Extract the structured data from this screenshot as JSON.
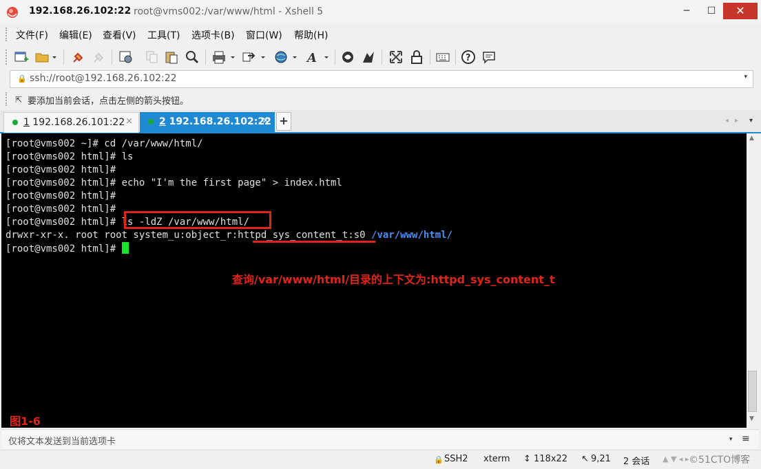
{
  "window": {
    "title_host": "192.168.26.102:22",
    "title_path": "root@vms002:/var/www/html - Xshell 5",
    "minimize": "─",
    "maximize": "☐",
    "close": "✕"
  },
  "menu": [
    "文件(F)",
    "编辑(E)",
    "查看(V)",
    "工具(T)",
    "选项卡(B)",
    "窗口(W)",
    "帮助(H)"
  ],
  "toolbar_icons": [
    "new-session-icon",
    "open-folder-icon",
    "reconnect-icon",
    "disconnect-icon",
    "properties-icon",
    "copy-icon",
    "paste-icon",
    "find-icon",
    "print-icon",
    "transfer-icon",
    "globe-icon",
    "font-icon",
    "xftp-icon",
    "xmanager-icon",
    "fullscreen-icon",
    "lock-icon",
    "keyboard-icon",
    "help-icon",
    "chat-icon"
  ],
  "address": {
    "value": "ssh://root@192.168.26.102:22",
    "lock": "🔒",
    "dropdown": "▾"
  },
  "hint": {
    "icon": "⇱",
    "text": "要添加当前会话，点击左侧的箭头按钮。"
  },
  "tabs": [
    {
      "num": "1",
      "label": " 192.168.26.101:22",
      "close": "×",
      "active": false
    },
    {
      "num": "2",
      "label": " 192.168.26.102:22",
      "close": "×",
      "active": true
    }
  ],
  "tab_add": "+",
  "tab_nav": {
    "left": "◂",
    "right": "▸",
    "menu": "▾"
  },
  "terminal": {
    "lines": [
      "[root@vms002 ~]# cd /var/www/html/",
      "[root@vms002 html]# ls",
      "[root@vms002 html]#",
      "[root@vms002 html]# echo \"I'm the first page\" > index.html",
      "[root@vms002 html]#",
      "[root@vms002 html]#",
      "[root@vms002 html]# ls -ldZ /var/www/html/"
    ],
    "listing": "drwxr-xr-x. root root system_u:object_r:httpd_sys_content_t:s0 ",
    "listing_dir": "/var/www/html/",
    "prompt": "[root@vms002 html]# "
  },
  "annotation": "查询/var/www/html/目录的上下文为:httpd_sys_content_t",
  "figure_label": "图1-6",
  "scroll": {
    "up": "▲",
    "down": "▼"
  },
  "send_bar": {
    "text": "仅将文本发送到当前选项卡",
    "dropdown": "▾",
    "menu": "≡"
  },
  "status": {
    "protocol": "SSH2",
    "protocol_icon": "🔒",
    "terminal": "xterm",
    "size_icon": "↕",
    "size": "118x22",
    "pos_icon": "↖",
    "position": "9,21",
    "sessions": "2 会话",
    "arrows": "▲ ▼ ◂ ▸",
    "watermark": "©51CTO博客"
  },
  "colors": {
    "accent": "#1f8ad1",
    "annotation": "#e0241b",
    "cursor": "#19e52c",
    "dir": "#4a8ef5",
    "close_button": "#c7362b"
  }
}
